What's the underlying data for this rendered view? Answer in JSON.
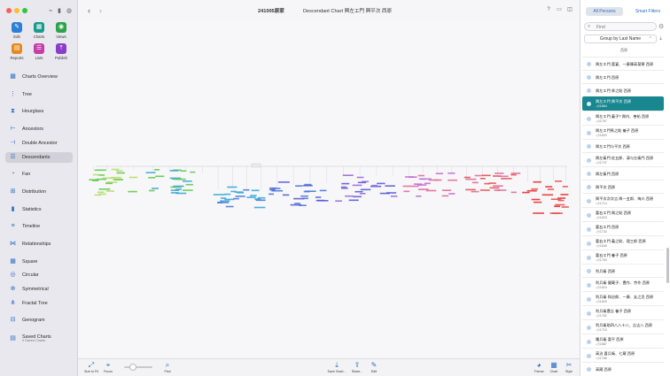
{
  "window": {
    "title_bar_icons": [
      "attachment-icon",
      "bookmark-icon",
      "people-icon"
    ]
  },
  "toolbar_tools": [
    {
      "label": "Edit",
      "icon": "pencil-icon",
      "color": "#2d7fd6"
    },
    {
      "label": "Charts",
      "icon": "charts-icon",
      "color": "#1b9a8a"
    },
    {
      "label": "Views",
      "icon": "eye-icon",
      "color": "#2da34b"
    },
    {
      "label": "Reports",
      "icon": "reports-icon",
      "color": "#e58a1c"
    },
    {
      "label": "Lists",
      "icon": "lists-icon",
      "color": "#c43da8"
    },
    {
      "label": "Publish",
      "icon": "publish-icon",
      "color": "#8a3ec8"
    }
  ],
  "sidebar": {
    "items": [
      {
        "label": "Charts Overview",
        "icon": "grid-icon",
        "active": false
      },
      {
        "label": "Tree",
        "icon": "tree-icon",
        "active": false
      },
      {
        "label": "Hourglass",
        "icon": "hourglass-icon",
        "active": false
      },
      {
        "label": "Ancestors",
        "icon": "ancestors-icon",
        "active": false
      },
      {
        "label": "Double Ancestor",
        "icon": "double-ancestor-icon",
        "active": false
      },
      {
        "label": "Descendants",
        "icon": "descendants-icon",
        "active": true
      },
      {
        "label": "Fan",
        "icon": "fan-icon",
        "active": false
      },
      {
        "label": "Distribution",
        "icon": "distribution-icon",
        "active": false
      },
      {
        "label": "Statistics",
        "icon": "statistics-icon",
        "active": false
      },
      {
        "label": "Timeline",
        "icon": "timeline-icon",
        "active": false
      },
      {
        "label": "Relationships",
        "icon": "relationships-icon",
        "active": false
      },
      {
        "label": "Square",
        "icon": "square-icon",
        "active": false
      },
      {
        "label": "Circular",
        "icon": "circular-icon",
        "active": false
      },
      {
        "label": "Symmetrical",
        "icon": "symmetrical-icon",
        "active": false
      },
      {
        "label": "Fractal Tree",
        "icon": "fractal-tree-icon",
        "active": false
      },
      {
        "label": "Genogram",
        "icon": "genogram-icon",
        "active": false
      }
    ],
    "saved": {
      "label": "Saved Charts",
      "sub": "0 Saved Charts"
    }
  },
  "header": {
    "document": "241005原家",
    "chart_title": "Descendant Chart 興左エ門 興平次 西原"
  },
  "bottom_bar": {
    "left": [
      {
        "label": "Size to Fit",
        "icon": "size-to-fit-icon"
      },
      {
        "label": "Focus",
        "icon": "focus-icon"
      }
    ],
    "zoom_level": 0.3,
    "find_label": "Find",
    "center": [
      {
        "label": "Save Chart...",
        "icon": "download-icon"
      },
      {
        "label": "Share...",
        "icon": "share-icon"
      },
      {
        "label": "Edit",
        "icon": "edit-icon"
      }
    ],
    "right": [
      {
        "label": "Theme",
        "icon": "theme-icon"
      },
      {
        "label": "Chart",
        "icon": "chart-icon"
      },
      {
        "label": "Style",
        "icon": "style-icon"
      }
    ]
  },
  "right_panel": {
    "tabs": {
      "all": "All Persons",
      "smart": "Smart Filters"
    },
    "find_placeholder": "Find",
    "group_by": "Group by Last Name",
    "section": "西原",
    "persons": [
      {
        "name": "興左エ門 喜宴、一康陳高菊寮 西原",
        "date": ""
      },
      {
        "name": "興左エ門 西原",
        "date": ""
      },
      {
        "name": "興左エ門 季之助 西原",
        "date": ""
      },
      {
        "name": "興左エ門 興平次 西原",
        "date": "-小1664",
        "selected": true
      },
      {
        "name": "興左エ門 義子? 興内、善祐 西原",
        "date": "-小1787"
      },
      {
        "name": "興左エ門馬之助 養子 西原",
        "date": "-小1820"
      },
      {
        "name": "興左エ門与平次 西原",
        "date": ""
      },
      {
        "name": "興左衛門 佐五郎、清与左衛門 西原",
        "date": "-小1747"
      },
      {
        "name": "興左衛門 西原",
        "date": ""
      },
      {
        "name": "興平次 西原",
        "date": ""
      },
      {
        "name": "興平次次次吉 興一五郎、梅川 西原",
        "date": "-小1714"
      },
      {
        "name": "要右エ門 興之助 西原",
        "date": "-小1823"
      },
      {
        "name": "要右エ門 西原",
        "date": "-小1730"
      },
      {
        "name": "要右エ門 義之助、理三郎 西原",
        "date": "-小1849"
      },
      {
        "name": "要右エ門 養子 西原",
        "date": "-小1783"
      },
      {
        "name": "利兵衛 西原",
        "date": ""
      },
      {
        "name": "利兵衛 健蔵子、豊作、京作 西原",
        "date": "-小1824"
      },
      {
        "name": "利兵衛 和治郎、一康、友之丞 西原",
        "date": "-小1825"
      },
      {
        "name": "利兵衛豊吉 養子 西原",
        "date": "-小1762"
      },
      {
        "name": "利兵衛助四八八十八、吉吉八 西原",
        "date": "-小1715"
      },
      {
        "name": "種兵衛 喜平 西原",
        "date": "-小1887"
      },
      {
        "name": "高治 喜兵衛、七蔵 西原",
        "date": "-小1786"
      },
      {
        "name": "高蔵 西原",
        "date": ""
      }
    ]
  },
  "chart_data": {
    "type": "descendant-tree",
    "generation_colors": [
      "#b5dd6a",
      "#62c94e",
      "#3aa6d6",
      "#4a78d8",
      "#5a5ad6",
      "#9a6ad6",
      "#c46ad6",
      "#e06a9a",
      "#e85050",
      "#e83030"
    ]
  }
}
